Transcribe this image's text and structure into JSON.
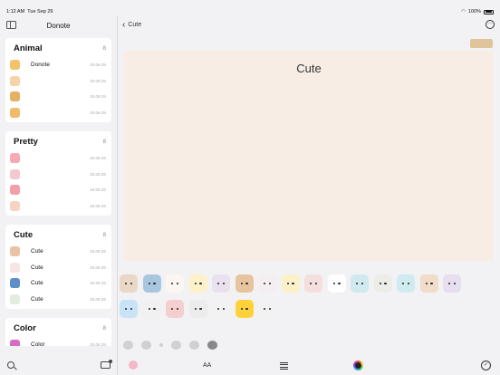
{
  "status_bar": {
    "time": "1:12 AM",
    "date": "Tue Sep 29",
    "battery": "100%"
  },
  "sidebar": {
    "title": "Donote",
    "groups": [
      {
        "name": "Animal",
        "count": "8",
        "items": [
          {
            "label": "Donote",
            "date": "20.09.29.",
            "color": "#f2c36b"
          },
          {
            "label": "",
            "date": "20.09.29.",
            "color": "#f5d2a8"
          },
          {
            "label": "",
            "date": "20.09.29.",
            "color": "#e8b066"
          },
          {
            "label": "",
            "date": "20.09.29.",
            "color": "#f0bb6a"
          }
        ]
      },
      {
        "name": "Pretty",
        "count": "8",
        "items": [
          {
            "label": "",
            "date": "20.09.29.",
            "color": "#f7a9b4"
          },
          {
            "label": "",
            "date": "20.09.29.",
            "color": "#f3c9cf"
          },
          {
            "label": "",
            "date": "20.09.29.",
            "color": "#f4a0a8"
          },
          {
            "label": "",
            "date": "20.09.29.",
            "color": "#f7d3c4"
          }
        ]
      },
      {
        "name": "Cute",
        "count": "8",
        "items": [
          {
            "label": "Cute",
            "date": "20.09.29.",
            "color": "#e9c3a6"
          },
          {
            "label": "Cute",
            "date": "20.09.29.",
            "color": "#f4e6e4"
          },
          {
            "label": "Cute",
            "date": "20.09.29.",
            "color": "#5c8fc7"
          },
          {
            "label": "Cute",
            "date": "20.09.29.",
            "color": "#e3ece1"
          }
        ]
      },
      {
        "name": "Color",
        "count": "8",
        "items": [
          {
            "label": "Color",
            "date": "20.09.29.",
            "color": "#d66bc2"
          }
        ]
      }
    ]
  },
  "main": {
    "back_label": "Cute",
    "canvas_title": "Cute"
  },
  "stickers": {
    "row1": [
      "#ebd7c6",
      "#a8c7de",
      "#fbf6f2",
      "#fcf1c9",
      "#e9e1ee",
      "#e8c49e",
      "#f4eef0",
      "#fbf1c9",
      "#f5dede",
      "#ffffff",
      "#cfe9ef",
      "#ecece8",
      "#d0ebef",
      "#f0dcc8",
      "#e7def0"
    ],
    "row2": [
      "#c8e3f5",
      "#f1f1f1",
      "#f5cfcf",
      "#ececec",
      "#f2f2f2",
      "#ffd23c",
      "#f2f2f2"
    ]
  },
  "toolbar": {
    "text_label": "AA",
    "done_glyph": "✓"
  },
  "colors": {
    "canvas_bg": "#f7ede4",
    "sidebar_bg": "#f2f2f4"
  }
}
